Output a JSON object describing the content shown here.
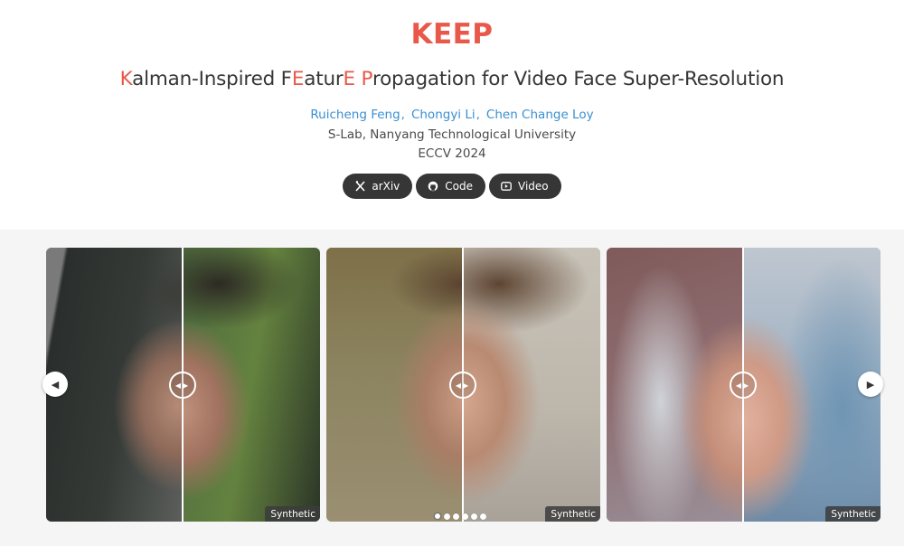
{
  "header": {
    "brand": "KEEP",
    "brand_color": "#e8594a",
    "title_parts": [
      {
        "text": "K",
        "highlight": true
      },
      {
        "text": "alman-Inspired F",
        "highlight": false
      },
      {
        "text": "E",
        "highlight": true
      },
      {
        "text": "atur",
        "highlight": false
      },
      {
        "text": "E",
        "highlight": true
      },
      {
        "text": " ",
        "highlight": false
      },
      {
        "text": "P",
        "highlight": true
      },
      {
        "text": "ropagation for Video Face Super-Resolution",
        "highlight": false
      }
    ],
    "authors": [
      "Ruicheng Feng",
      "Chongyi Li",
      "Chen Change Loy"
    ],
    "author_separator": ",",
    "affiliation": "S-Lab, Nanyang Technological University",
    "venue": "ECCV 2024",
    "links": [
      {
        "label": "arXiv",
        "icon": "arxiv-icon"
      },
      {
        "label": "Code",
        "icon": "github-icon"
      },
      {
        "label": "Video",
        "icon": "youtube-icon"
      }
    ]
  },
  "gallery": {
    "prev_icon": "chevron-left-icon",
    "next_icon": "chevron-right-icon",
    "slides": [
      {
        "tag": "Synthetic",
        "subject": "young man, green-tinted background"
      },
      {
        "tag": "Synthetic",
        "subject": "young man with light beard"
      },
      {
        "tag": "Synthetic",
        "subject": "woman with blue-grey hair"
      }
    ],
    "page_count": 6,
    "active_page": 0
  },
  "colors": {
    "accent": "#e8594a",
    "link": "#3b8fd0",
    "button_bg": "#363636",
    "text": "#363636"
  }
}
